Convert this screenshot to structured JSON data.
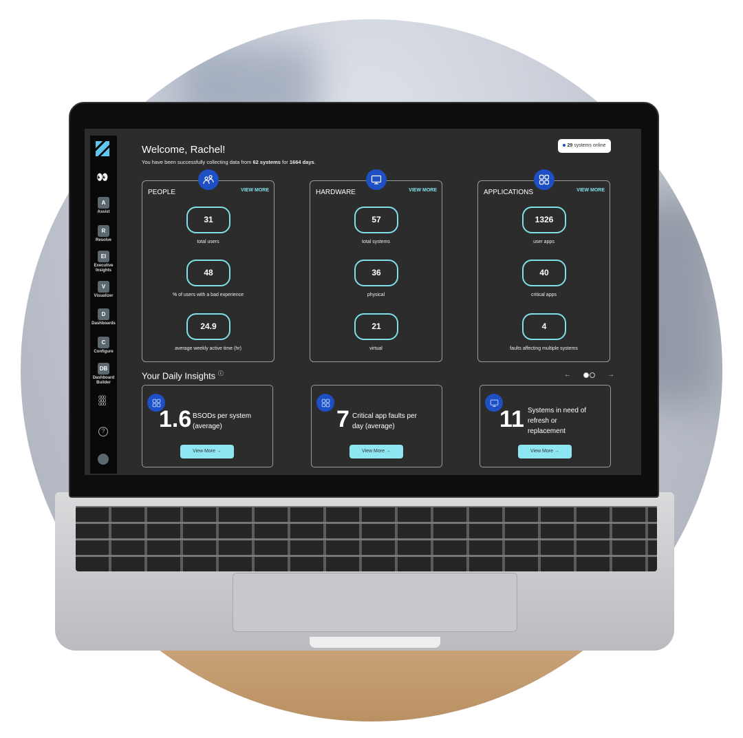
{
  "sidebar": {
    "items": [
      {
        "abbr": "A",
        "label": "Assist"
      },
      {
        "abbr": "R",
        "label": "Resolve"
      },
      {
        "abbr": "EI",
        "label": "Executive Insights"
      },
      {
        "abbr": "V",
        "label": "Visualizer"
      },
      {
        "abbr": "D",
        "label": "Dashboards"
      },
      {
        "abbr": "C",
        "label": "Configure"
      },
      {
        "abbr": "DB",
        "label": "Dashboard Builder"
      }
    ]
  },
  "header": {
    "welcome": "Welcome, Rachel!",
    "sub_prefix": "You have been successfully collecting data from ",
    "systems": "62 systems",
    "sub_mid": " for ",
    "days": "1664 days",
    "sub_suffix": ".",
    "online_count": "29",
    "online_label": " systems online"
  },
  "cards": [
    {
      "title": "PEOPLE",
      "view_more": "VIEW MORE",
      "icon": "people-icon",
      "stats": [
        {
          "value": "31",
          "label": "total users"
        },
        {
          "value": "48",
          "label": "% of users with a bad experience"
        },
        {
          "value": "24.9",
          "label": "average weekly active time (hr)"
        }
      ]
    },
    {
      "title": "HARDWARE",
      "view_more": "VIEW MORE",
      "icon": "monitor-icon",
      "stats": [
        {
          "value": "57",
          "label": "total systems"
        },
        {
          "value": "36",
          "label": "physical"
        },
        {
          "value": "21",
          "label": "virtual"
        }
      ]
    },
    {
      "title": "APPLICATIONS",
      "view_more": "VIEW MORE",
      "icon": "apps-grid-icon",
      "stats": [
        {
          "value": "1326",
          "label": "user apps"
        },
        {
          "value": "40",
          "label": "critical apps"
        },
        {
          "value": "4",
          "label": "faults affecting multiple systems"
        }
      ]
    }
  ],
  "insights": {
    "heading": "Your Daily Insights",
    "items": [
      {
        "value": "1.6",
        "desc": "BSODs per system (average)",
        "button": "View More →",
        "icon": "apps-grid-icon"
      },
      {
        "value": "7",
        "desc": "Critical app faults per day (average)",
        "button": "View More →",
        "icon": "apps-grid-icon"
      },
      {
        "value": "11",
        "desc": "Systems in need of refresh or replacement",
        "button": "View More →",
        "icon": "monitor-icon"
      }
    ],
    "prev": "←",
    "next": "→",
    "page": 1,
    "pages": 2
  },
  "colors": {
    "accent": "#7fe0ea",
    "icon_bg": "#1f4fc4",
    "screen_bg": "#2c2c2c"
  }
}
